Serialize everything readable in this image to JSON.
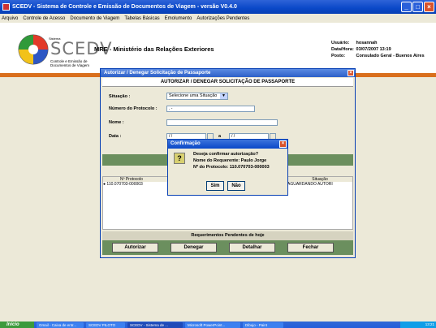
{
  "window": {
    "title": "SCEDV - Sistema de Controle e Emissão de Documentos de Viagem - versão V0.4.0"
  },
  "menu": [
    "Arquivo",
    "Controle de Acesso",
    "Documento de Viagem",
    "Tabelas Básicas",
    "Emolumento",
    "Autorizações Pendentes"
  ],
  "header": {
    "logo_small": "Sistema",
    "logo_text": "SCEDV",
    "logo_sub1": "Controle e Emissão de",
    "logo_sub2": "Documentos de Viagem",
    "org_title": "MRE - Ministério das Relações Exteriores",
    "user_label": "Usuário:",
    "user_value": "hosannah",
    "date_label": "Data/Hora:",
    "date_value": "03/07/2007 13:19",
    "post_label": "Posto:",
    "post_value": "Consulado Geral - Buenos Aires"
  },
  "form": {
    "window_title": "Autorizar / Denegar Solicitação de Passaporte",
    "heading": "AUTORIZAR / DENEGAR SOLICITAÇÃO DE PASSAPORTE",
    "situacao_label": "Situação :",
    "situacao_value": "Selecione uma Situação",
    "protocolo_label": "Número do Protocolo :",
    "protocolo_value": "  .      -",
    "nome_label": "Nome :",
    "data_label": "Data :",
    "data_from": "/ /",
    "data_sep": "a",
    "data_to": "/ /",
    "grid_headers": [
      "Nº Protocolo",
      "Situação"
    ],
    "grid_rows": [
      {
        "protocolo": "110.070703-000003",
        "situacao": "AGUARDANDO AUTORI"
      }
    ],
    "pending_label": "Requerimentos Pendentes de hoje",
    "buttons": {
      "autorizar": "Autorizar",
      "denegar": "Denegar",
      "detalhar": "Detalhar",
      "fechar": "Fechar"
    }
  },
  "confirm": {
    "title": "Confirmação",
    "question": "Deseja confirmar autorização?",
    "line_name": "Nome do Requerente: Paulo Jorge",
    "line_protocol": "Nº do Protocolo:  110.070703-000003",
    "yes": "Sim",
    "no": "Não"
  },
  "taskbar": {
    "start": "Início",
    "tasks": [
      "Gmail - Caixa de entr...",
      "SCEDV PILOTO",
      "SCEDV - Sistema de ...",
      "Microsoft PowerPoint...",
      "Dibujo - Paint"
    ],
    "clock": "13:21"
  }
}
